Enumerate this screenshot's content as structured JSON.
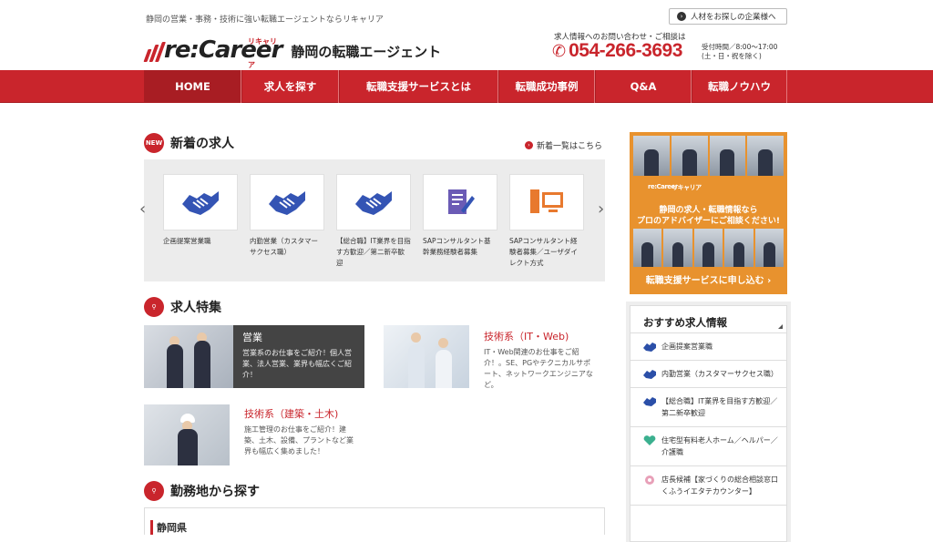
{
  "header": {
    "tagline": "静岡の営業・事務・技術に強い転職エージェントならリキャリア",
    "corp_link": "人材をお探しの企業様へ",
    "logo_text": "re:Career",
    "logo_kana": "リキャリア",
    "logo_sub": "静岡の転職エージェント",
    "contact_label": "求人情報へのお問い合わせ・ご相談は",
    "phone": "054-266-3693",
    "hours_line1": "受付時間／8:00〜17:00",
    "hours_line2": "(土・日・祝を除く)"
  },
  "nav": {
    "items": [
      "HOME",
      "求人を探す",
      "転職支援サービスとは",
      "転職成功事例",
      "Q&A",
      "転職ノウハウ"
    ]
  },
  "new_jobs": {
    "badge": "NEW",
    "title": "新着の求人",
    "more_link": "新着一覧はこちら",
    "cards": [
      {
        "caption": "企画提案営業職",
        "icon": "handshake-icon"
      },
      {
        "caption": "内勤営業（カスタマーサクセス職）",
        "icon": "handshake-icon"
      },
      {
        "caption": "【総合職】IT業界を目指す方歓迎／第二新卒歓迎",
        "icon": "handshake-icon"
      },
      {
        "caption": "SAPコンサルタント基幹業務経験者募集",
        "icon": "document-icon"
      },
      {
        "caption": "SAPコンサルタント経験者募集／ユーザダイレクト方式",
        "icon": "computer-icon"
      }
    ]
  },
  "features": {
    "title": "求人特集",
    "items": [
      {
        "title": "営業",
        "desc": "営業系のお仕事をご紹介！個人営業、法人営業、業界も幅広くご紹介！"
      },
      {
        "title": "技術系（IT・Web)",
        "desc": "IT・Web関連のお仕事をご紹介！。SE、PGやテクニカルサポート、ネットワークエンジニアなど。"
      },
      {
        "title": "技術系（建築・土木)",
        "desc": "施工管理のお仕事をご紹介！建築、土木、設備、プラントなど業界も幅広く集めました！"
      }
    ]
  },
  "location": {
    "title": "勤務地から探す",
    "region": "静岡県"
  },
  "banner": {
    "logo": "re:Career",
    "kana": "リキャリア",
    "line1": "静岡の求人・転職情報なら",
    "line2": "プロのアドバイザーにご相談ください!",
    "cta": "転職支援サービスに申し込む ›"
  },
  "recommended": {
    "title": "おすすめ求人情報",
    "items": [
      {
        "text": "企画提案営業職",
        "color": "#2b4fa8"
      },
      {
        "text": "内勤営業（カスタマーサクセス職）",
        "color": "#2b4fa8"
      },
      {
        "text": "【総合職】IT業界を目指す方歓迎／第二新卒歓迎",
        "color": "#2b4fa8"
      },
      {
        "text": "住宅型有料老人ホーム／ヘルパー／介護職",
        "color": "#3bb08f"
      },
      {
        "text": "店長候補【家づくりの総合相談窓口くふうイエタテカウンター】",
        "color": "#e8a0b8"
      }
    ]
  }
}
